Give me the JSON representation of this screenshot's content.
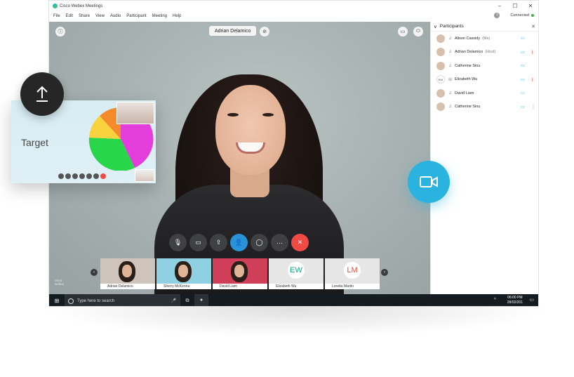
{
  "window": {
    "title": "Cisco Webex Meetings",
    "controls": [
      "–",
      "☐",
      "✕"
    ]
  },
  "menu": [
    "File",
    "Edit",
    "Share",
    "View",
    "Audio",
    "Participant",
    "Meeting",
    "Help"
  ],
  "status": {
    "text": "Connected",
    "help": "?"
  },
  "stage": {
    "speaker": "Adrian Delamico",
    "cisco": "cisco",
    "webex": "webex"
  },
  "controls": [
    {
      "name": "mute-button",
      "icon": "microphone-off-icon",
      "glyph": "🎙"
    },
    {
      "name": "video-button",
      "icon": "video-off-icon",
      "glyph": "▭"
    },
    {
      "name": "share-button",
      "icon": "share-icon",
      "glyph": "⇪"
    },
    {
      "name": "participants-button",
      "icon": "person-icon",
      "glyph": "👤"
    },
    {
      "name": "chat-button",
      "icon": "chat-icon",
      "glyph": "◯"
    },
    {
      "name": "more-button",
      "icon": "more-icon",
      "glyph": "···"
    },
    {
      "name": "leave-button",
      "icon": "close-icon",
      "glyph": "✕"
    }
  ],
  "strip": [
    {
      "name": "Adrian Delamico",
      "initials": "",
      "bg": "#cfc4bb"
    },
    {
      "name": "Sherry McKenna",
      "initials": "",
      "bg": "#8fd0e2"
    },
    {
      "name": "David Liam",
      "initials": "",
      "bg": "#cf3f57"
    },
    {
      "name": "Elizabeth Wu",
      "initials": "EW",
      "bg": "#e6e6e6",
      "color": "#17a58f"
    },
    {
      "name": "Loretta Martin",
      "initials": "LM",
      "bg": "#e6e6e6",
      "color": "#e0533d"
    }
  ],
  "panel": {
    "title": "Participants",
    "close": "✕",
    "chevron": "∨",
    "participants": [
      {
        "name": "Alison Cassidy",
        "role": "(Me)",
        "device": "headset-icon",
        "initials": "",
        "video": true,
        "mute": ""
      },
      {
        "name": "Adrian Delamico",
        "role": "(Host)",
        "device": "headset-icon",
        "initials": "",
        "video": true,
        "mute": "red"
      },
      {
        "name": "Catherine Sinu",
        "role": "",
        "device": "headset-icon",
        "initials": "",
        "video": true,
        "mute": ""
      },
      {
        "name": "Elizabeth Wu",
        "role": "",
        "device": "phone-icon",
        "initials": "EW",
        "video": true,
        "mute": "red"
      },
      {
        "name": "David Liam",
        "role": "",
        "device": "headset-icon",
        "initials": "",
        "video": true,
        "mute": ""
      },
      {
        "name": "Catherine Sinu",
        "role": "",
        "device": "headset-icon",
        "initials": "",
        "video": true,
        "mute": "green"
      }
    ]
  },
  "taskbar": {
    "search_placeholder": "Type here to search",
    "time": "06:00 PM",
    "date": "28/02/201"
  },
  "card": {
    "label": "Target"
  },
  "colors": {
    "accent": "#2bb3e0",
    "danger": "#ef4b44",
    "active": "#2a92d6",
    "pie": [
      "#e33ddb",
      "#28d649",
      "#f8d33e",
      "#f58a2b"
    ]
  }
}
